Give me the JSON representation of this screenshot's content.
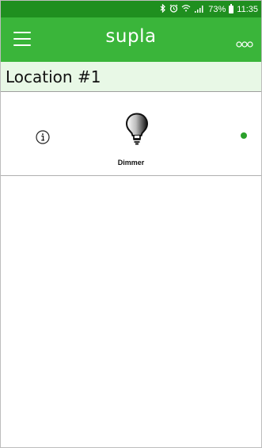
{
  "status_bar": {
    "battery_text": "73%",
    "time": "11:35",
    "icons": [
      "bluetooth-icon",
      "alarm-icon",
      "wifi-icon",
      "signal-icon",
      "battery-icon"
    ]
  },
  "app_bar": {
    "title": "supla",
    "menu_icon": "hamburger-menu-icon",
    "more_icon": "three-circles-icon",
    "color": "#3ab53a"
  },
  "location": {
    "name": "Location #1",
    "header_bg": "#e8f8e6"
  },
  "channels": [
    {
      "caption": "Dimmer",
      "icon": "bulb-icon",
      "info_icon": "info-icon",
      "online": true,
      "status_color": "#2aa02a"
    }
  ]
}
